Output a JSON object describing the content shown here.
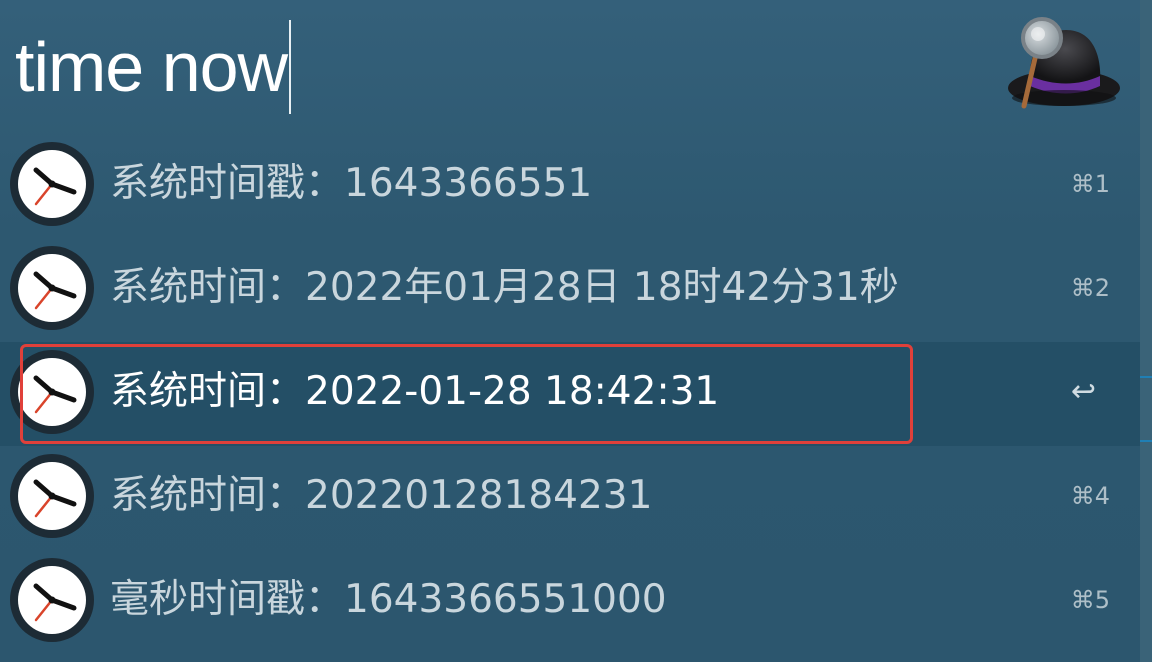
{
  "search": {
    "query": "time now"
  },
  "results": [
    {
      "text": "系统时间戳：1643366551",
      "shortcut": "⌘1",
      "icon": "clock-icon"
    },
    {
      "text": "系统时间：2022年01月28日 18时42分31秒",
      "shortcut": "⌘2",
      "icon": "clock-icon"
    },
    {
      "text": "系统时间：2022-01-28 18:42:31",
      "shortcut": "↩",
      "icon": "clock-icon",
      "selected": true
    },
    {
      "text": "系统时间：20220128184231",
      "shortcut": "⌘4",
      "icon": "clock-icon"
    },
    {
      "text": "毫秒时间戳：1643366551000",
      "shortcut": "⌘5",
      "icon": "clock-icon"
    }
  ],
  "colors": {
    "background": "#2c566e",
    "selected_row": "#244f66",
    "highlight_border": "#e0403a",
    "text": "#c9d6dd",
    "selected_text": "#ffffff"
  }
}
